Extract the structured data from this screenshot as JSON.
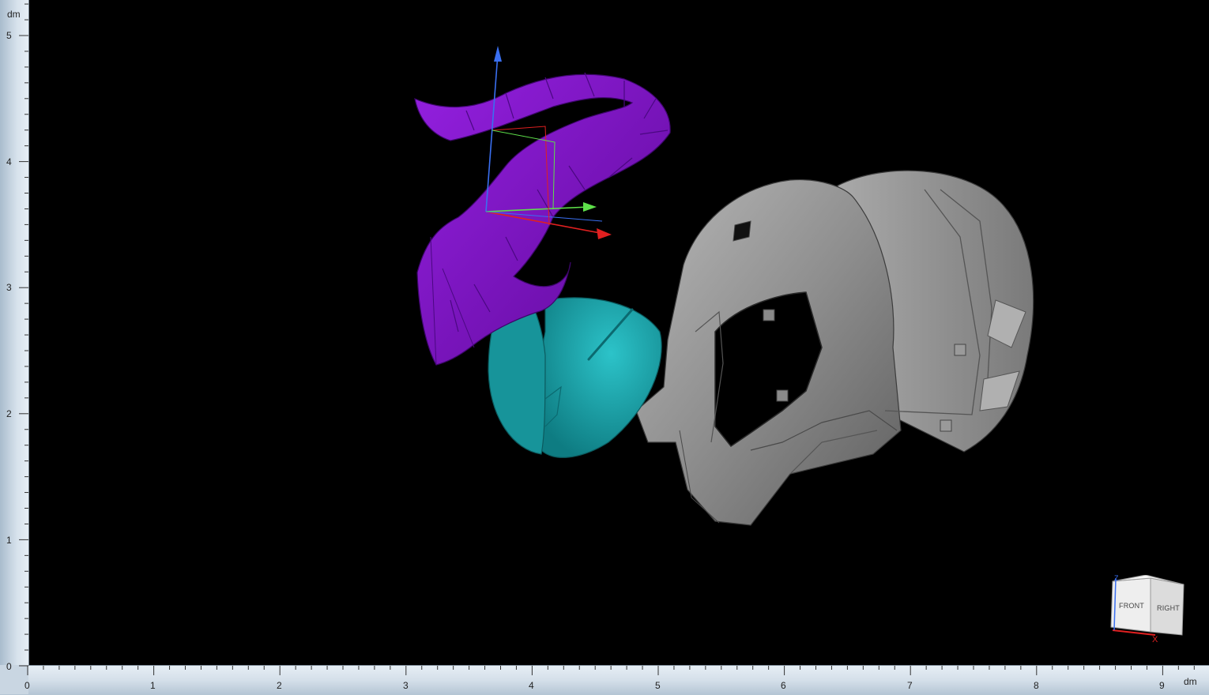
{
  "rulers": {
    "vertical_unit": "dm",
    "horizontal_unit": "dm",
    "vertical_ticks": [
      "0",
      "1",
      "2",
      "3",
      "4",
      "5"
    ],
    "horizontal_ticks": [
      "0",
      "1",
      "2",
      "3",
      "4",
      "5",
      "6",
      "7",
      "8",
      "9"
    ]
  },
  "view_cube": {
    "front_label": "FRONT",
    "right_label": "RIGHT",
    "z_label": "Z",
    "x_label": "X"
  },
  "colors": {
    "background": "#000000",
    "purple_part": "#7e11c4",
    "teal_part": "#1aa6ad",
    "gray_part": "#9a9a9a",
    "axis_x": "#e02020",
    "axis_y": "#5ee04a",
    "axis_z": "#3a6ff0"
  }
}
